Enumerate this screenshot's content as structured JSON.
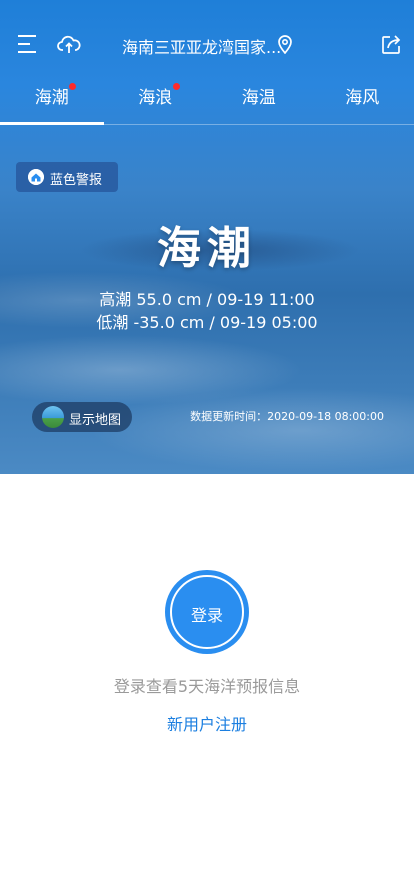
{
  "header": {
    "location": "海南三亚亚龙湾国家...",
    "menu_icon": "menu-icon",
    "upload_icon": "cloud-upload-icon",
    "location_icon": "location-pin-icon",
    "share_icon": "share-icon"
  },
  "tabs": [
    {
      "label": "海潮",
      "badge": true,
      "active": true
    },
    {
      "label": "海浪",
      "badge": true,
      "active": false
    },
    {
      "label": "海温",
      "badge": false,
      "active": false
    },
    {
      "label": "海风",
      "badge": false,
      "active": false
    }
  ],
  "alert": {
    "label": "蓝色警报",
    "icon": "alert-house-icon"
  },
  "hero": {
    "title": "海潮",
    "high_tide": "高潮 55.0 cm / 09-19 11:00",
    "low_tide": "低潮 -35.0 cm / 09-19 05:00"
  },
  "map_button": {
    "label": "显示地图",
    "icon": "map-globe-icon"
  },
  "update_time": "数据更新时间：2020-09-18 08:00:00",
  "login": {
    "button_label": "登录",
    "tip": "登录查看5天海洋预报信息",
    "register": "新用户注册"
  },
  "colors": {
    "brand_blue": "#2a8ef0",
    "badge_red": "#ff2a2a",
    "tip_gray": "#9a9a9a",
    "link_blue": "#1c7fe0"
  }
}
